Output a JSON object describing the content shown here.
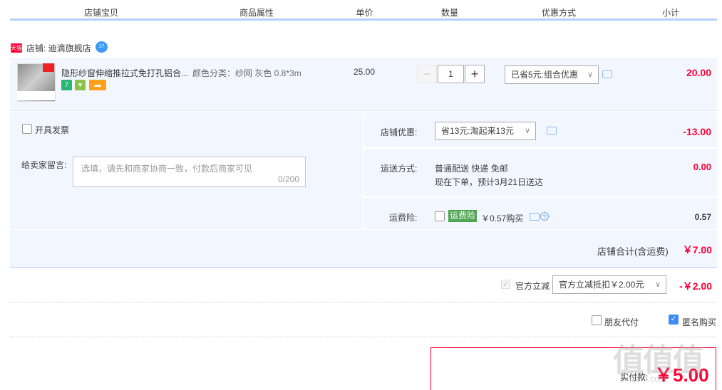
{
  "columns": {
    "shop_item": "店铺宝贝",
    "attributes": "商品属性",
    "unit_price": "单价",
    "quantity": "数量",
    "discount": "优惠方式",
    "subtotal": "小计"
  },
  "shop": {
    "badge": "天猫",
    "label": "店铺: 迪滴旗舰店",
    "ww_badge": "17"
  },
  "item": {
    "title": "隐形纱窗伸缩推拉式免打孔铝合...",
    "attribute": "颜色分类：纱网 灰色 0.8*3m",
    "price": "25.00",
    "quantity": "1",
    "minus": "−",
    "plus": "+",
    "discount_select": "已省5元:组合优惠",
    "subtotal": "20.00",
    "service_icons": [
      "7",
      "♥",
      "▬"
    ]
  },
  "invoice": {
    "label": "开具发票"
  },
  "message": {
    "label": "给卖家留言:",
    "placeholder": "选填，请先和商家协商一致，付款后商家可见",
    "counter": "0/200"
  },
  "shop_discount": {
    "label": "店铺优惠:",
    "select": "省13元:淘起来13元",
    "amount": "-13.00"
  },
  "shipping": {
    "label": "运送方式:",
    "method": "普通配送 快递 免邮",
    "eta": "现在下单，预计3月21日送达",
    "amount": "0.00"
  },
  "insurance": {
    "label": "运费险:",
    "badge": "运费险",
    "price": "￥0.57购买",
    "amount": "0.57"
  },
  "shop_total": {
    "label": "店铺合计(含运费)",
    "amount": "￥7.00"
  },
  "official_discount": {
    "label": "官方立减",
    "select": "官方立减抵扣￥2.00元",
    "amount": "-￥2.00"
  },
  "options": {
    "friend_pay": "朋友代付",
    "anonymous": "匿名购买"
  },
  "payment": {
    "label": "实付款:",
    "amount": "￥5.00"
  },
  "watermark": {
    "logo": "值值值",
    "site": "smzdm.com"
  },
  "colors": {
    "accent_red": "#ff0036",
    "light_blue_bg": "#f2f7ff",
    "header_line": "#b2d1ff",
    "checkbox_blue": "#3d8cf5",
    "insurance_green": "#4ea451"
  }
}
